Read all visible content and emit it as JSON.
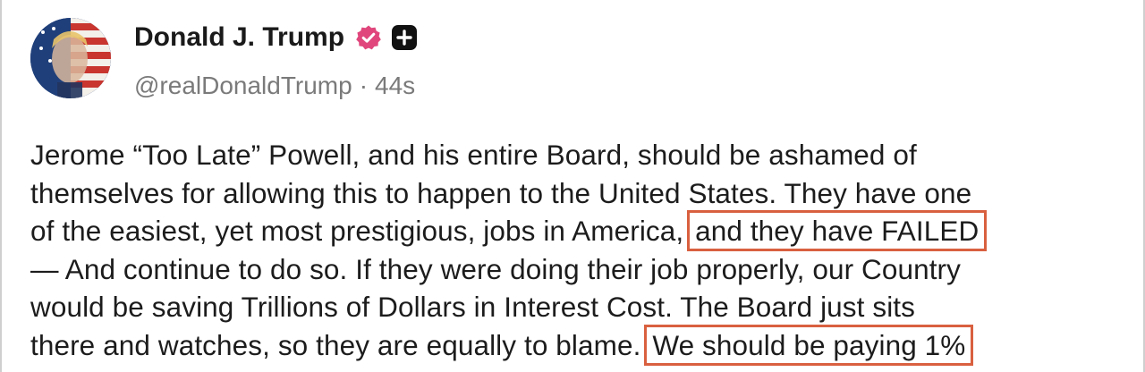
{
  "post": {
    "author": {
      "display_name": "Donald J. Trump",
      "handle": "@realDonaldTrump",
      "separator": "·",
      "time": "44s",
      "verified_icon": "verified-check-icon",
      "plus_icon": "plus-square-icon",
      "colors": {
        "verified_badge": "#e0467c",
        "plus_badge": "#111111"
      }
    },
    "body_lines": [
      "Jerome “Too Late” Powell, and his entire Board, should be ashamed of",
      "themselves for allowing this to happen to the United States. They have one",
      "of the easiest, yet most prestigious, jobs in America,",
      "— And continue to do so. If they were doing their job properly, our Country",
      "would be saving Trillions of Dollars in Interest Cost. The Board just sits",
      "there and watches, so they are equally to blame."
    ],
    "highlights": [
      "and they have FAILED",
      "We should be paying 1%"
    ],
    "colors": {
      "highlight_box": "#d9603f",
      "text": "#1c1c1c",
      "secondary_text": "#7a7a7a"
    }
  }
}
